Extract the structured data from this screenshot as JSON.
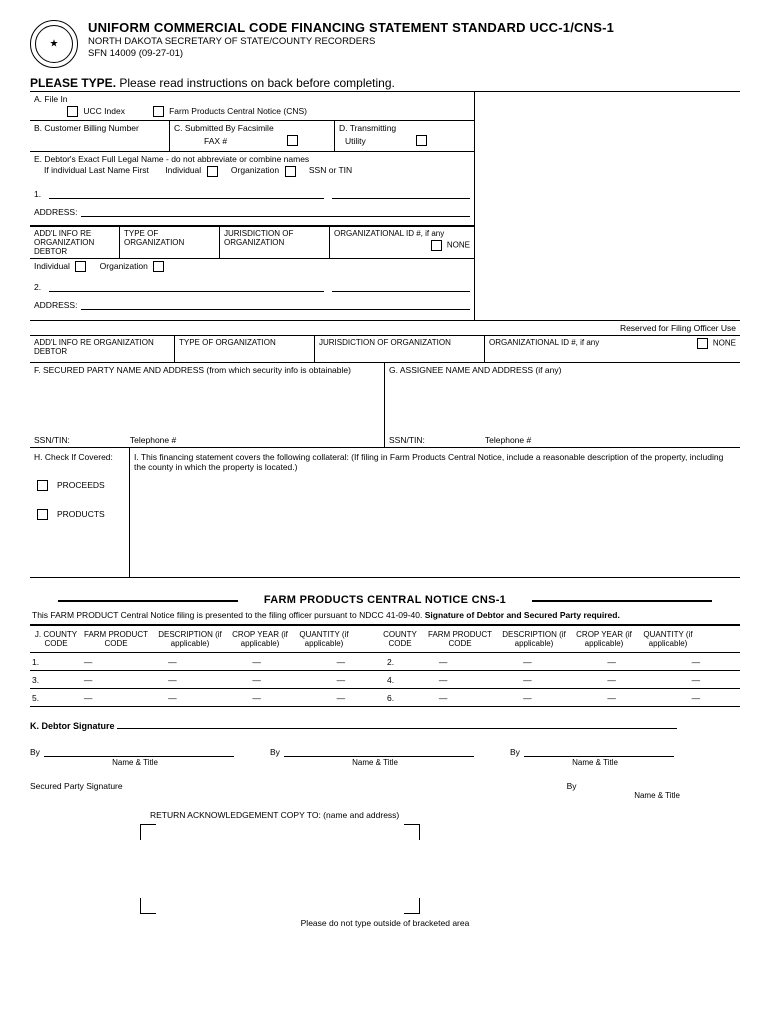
{
  "header": {
    "title": "UNIFORM COMMERCIAL CODE FINANCING STATEMENT STANDARD UCC-1/CNS-1",
    "sub1": "NORTH DAKOTA SECRETARY OF STATE/COUNTY RECORDERS",
    "sub2": "SFN 14009 (09-27-01)"
  },
  "please": {
    "bold": "PLEASE TYPE.",
    "rest": "Please read instructions on back before completing."
  },
  "a": {
    "label": "A.  File In",
    "ucc": "UCC Index",
    "cns": "Farm Products Central Notice (CNS)"
  },
  "b": {
    "label": "B.  Customer Billing Number"
  },
  "c": {
    "label": "C.  Submitted By Facsimile",
    "fax": "FAX #"
  },
  "d": {
    "label": "D.  Transmitting",
    "util": "Utility"
  },
  "e": {
    "label": "E.  Debtor's Exact Full Legal Name - do not abbreviate or combine names",
    "sub": "If individual Last Name First",
    "ind": "Individual",
    "org": "Organization",
    "ssn": "SSN or TIN",
    "n1": "1.",
    "addr": "ADDRESS:",
    "addl": "ADD'L INFO RE ORGANIZATION DEBTOR",
    "type": "TYPE OF ORGANIZATION",
    "jur": "JURISDICTION OF ORGANIZATION",
    "orgid": "ORGANIZATIONAL ID #, if any",
    "none": "NONE",
    "n2": "2."
  },
  "reserved": "Reserved for Filing Officer Use",
  "full": {
    "addl": "ADD'L INFO RE ORGANIZATION DEBTOR",
    "type": "TYPE OF ORGANIZATION",
    "jur": "JURISDICTION OF ORGANIZATION",
    "orgid": "ORGANIZATIONAL ID #, if any",
    "none": "NONE"
  },
  "f": {
    "label": "F. SECURED PARTY NAME AND ADDRESS (from which security info is obtainable)",
    "ssn": "SSN/TIN:",
    "tel": "Telephone #"
  },
  "g": {
    "label": "G.  ASSIGNEE NAME AND ADDRESS (if any)",
    "ssn": "SSN/TIN:",
    "tel": "Telephone #"
  },
  "h": {
    "label": "H. Check If Covered:",
    "proceeds": "PROCEEDS",
    "products": "PRODUCTS"
  },
  "i": {
    "text": "I.  This financing statement covers the following collateral:  (If filing in Farm Products Central Notice, include a reasonable description of the property, including the county in which the property is located.)"
  },
  "farm": {
    "title": "FARM PRODUCTS CENTRAL NOTICE CNS-1",
    "note": "This FARM PRODUCT Central Notice filing is presented to the filing officer pursuant to NDCC 41-09-40.",
    "note_bold": "Signature of Debtor and Secured Party required."
  },
  "j": {
    "county": "J.  COUNTY CODE",
    "fp": "FARM PRODUCT CODE",
    "desc": "DESCRIPTION (if applicable)",
    "crop": "CROP YEAR (if applicable)",
    "qty": "QUANTITY (if applicable)",
    "county2": "COUNTY CODE",
    "nums": [
      "1.",
      "3.",
      "5.",
      "2.",
      "4.",
      "6."
    ]
  },
  "k": {
    "label": "K.  Debtor Signature",
    "by": "By",
    "nt": "Name & Title",
    "sp": "Secured Party Signature"
  },
  "ret": {
    "label": "RETURN ACKNOWLEDGEMENT COPY TO: (name and address)"
  },
  "foot": "Please do not type outside of bracketed area"
}
